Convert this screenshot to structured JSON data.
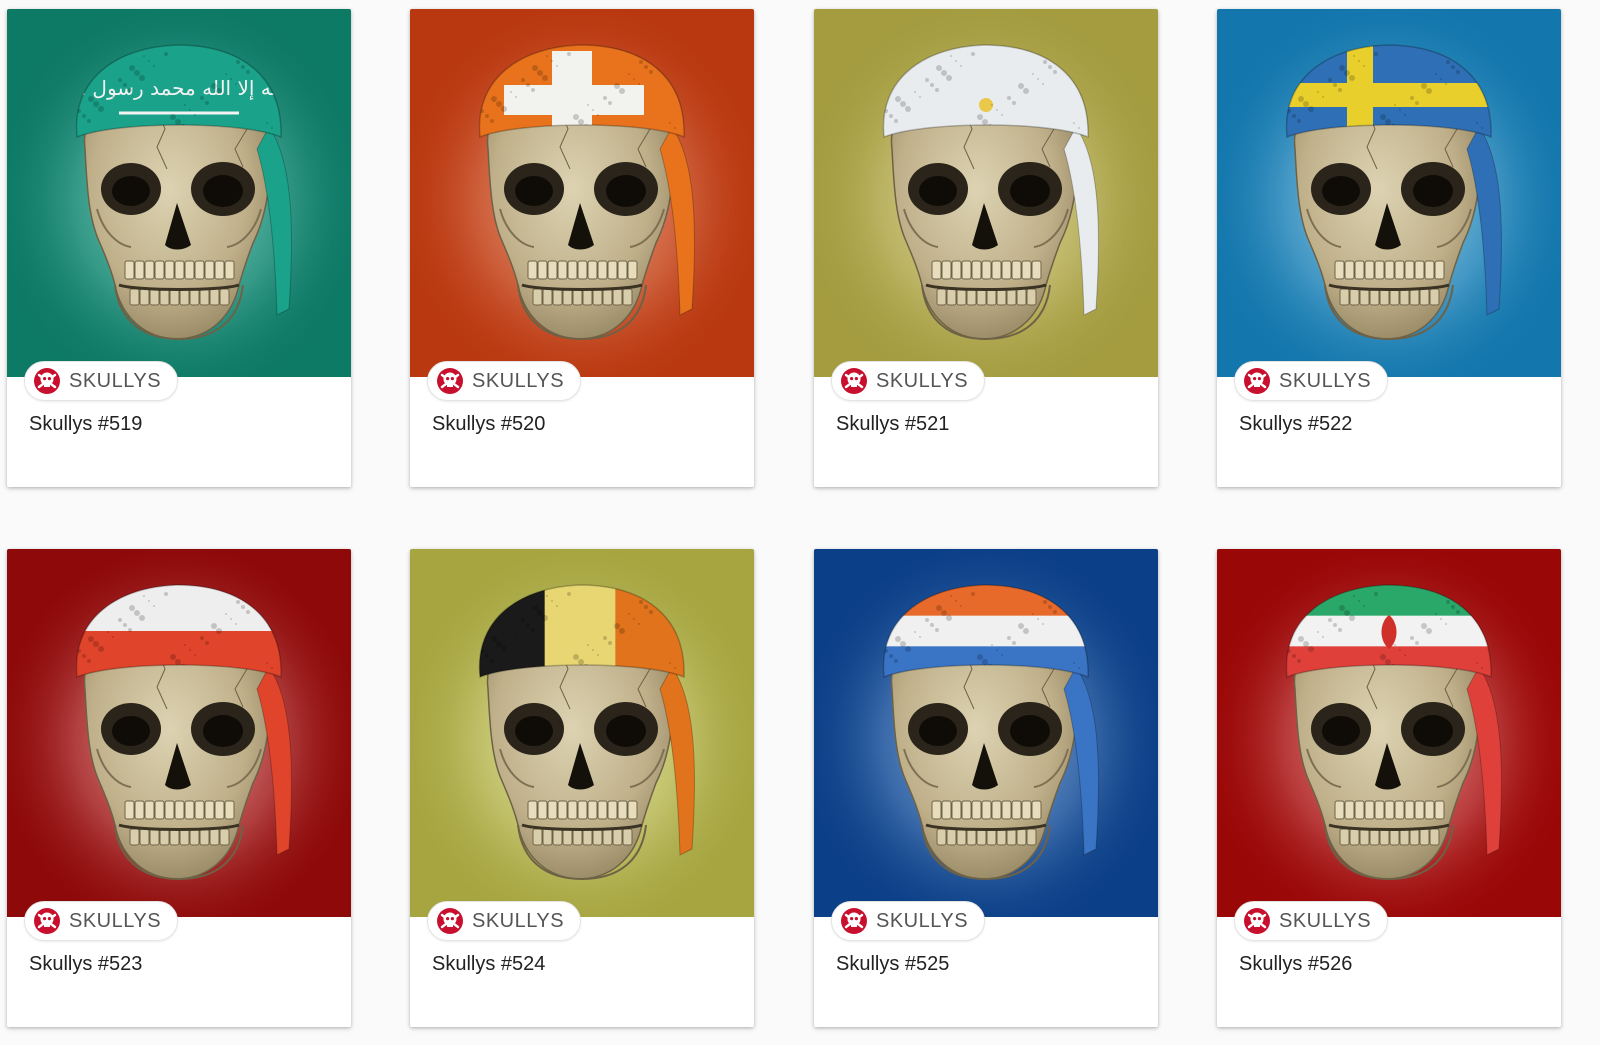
{
  "cards": [
    {
      "collection": "SKULLYS",
      "title": "Skullys #519",
      "bg": "#0d7a66",
      "glow": "#7fd3c3",
      "flag": "saudi",
      "flag_text": "لا إله إلا الله محمد رسول الله"
    },
    {
      "collection": "SKULLYS",
      "title": "Skullys #520",
      "bg": "#b9380f",
      "glow": "#f2a58a",
      "flag": "swiss"
    },
    {
      "collection": "SKULLYS",
      "title": "Skullys #521",
      "bg": "#a49c3f",
      "glow": "#e4dea4",
      "flag": "argentina"
    },
    {
      "collection": "SKULLYS",
      "title": "Skullys #522",
      "bg": "#1377ad",
      "glow": "#9cd3ee",
      "flag": "sweden"
    },
    {
      "collection": "SKULLYS",
      "title": "Skullys #523",
      "bg": "#8e0a0a",
      "glow": "#f0a0a0",
      "flag": "poland"
    },
    {
      "collection": "SKULLYS",
      "title": "Skullys #524",
      "bg": "#a6a540",
      "glow": "#eeeeb0",
      "flag": "belgium"
    },
    {
      "collection": "SKULLYS",
      "title": "Skullys #525",
      "bg": "#0b3f87",
      "glow": "#8fb6e6",
      "flag": "netherlands"
    },
    {
      "collection": "SKULLYS",
      "title": "Skullys #526",
      "bg": "#9a0707",
      "glow": "#f19a9a",
      "flag": "iran"
    }
  ],
  "colors": {
    "page_bg": "#fafafa",
    "badge_logo": "#c8102e"
  },
  "icons": {
    "badge_logo": "skull-crossbones-icon"
  }
}
